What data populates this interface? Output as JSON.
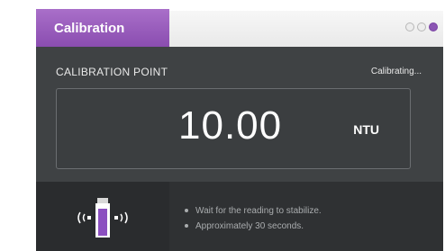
{
  "window": {
    "tab_label": "Calibration",
    "controls": [
      "circle-icon",
      "circle-icon",
      "circle-icon-active"
    ]
  },
  "calibration": {
    "label": "CALIBRATION POINT",
    "status": "Calibrating...",
    "value": "10.00",
    "unit": "NTU"
  },
  "instructions": {
    "icon": "vibrating-vial-icon",
    "tips": [
      "Wait for the reading to stabilize.",
      "Approximately 30 seconds."
    ]
  },
  "colors": {
    "accent": "#8a4db0",
    "panel": "#3f4244",
    "bottom": "#2f3133"
  }
}
